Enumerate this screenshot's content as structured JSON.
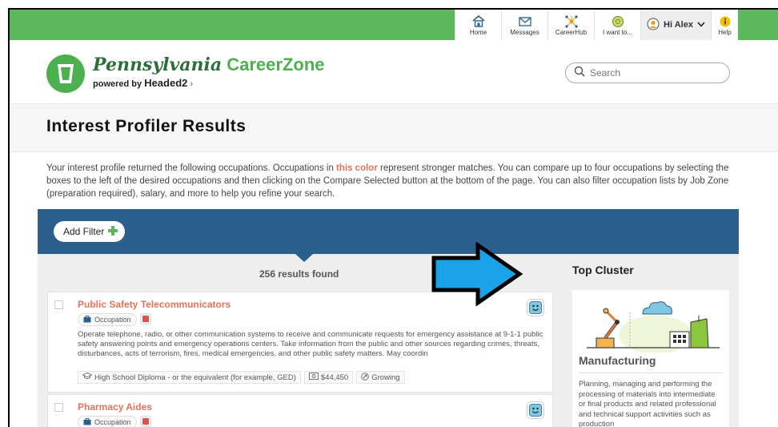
{
  "nav": {
    "items": [
      {
        "label": "Home",
        "icon": "home-icon"
      },
      {
        "label": "Messages",
        "icon": "envelope-icon"
      },
      {
        "label": "CareerHub",
        "icon": "network-icon"
      },
      {
        "label": "I want to...",
        "icon": "compass-icon"
      }
    ],
    "user_greeting": "Hi Alex",
    "help_label": "Help"
  },
  "logo": {
    "title_script": "Pennsylvania",
    "title_brand": "CareerZone",
    "powered_by": "powered by",
    "partner": "Headed2"
  },
  "search": {
    "placeholder": "Search"
  },
  "page_title": "Interest Profiler Results",
  "intro": {
    "part1": "Your interest profile returned the following occupations. Occupations in ",
    "accent": "this color",
    "part2": " represent stronger matches. You can compare up to four occupations by selecting the boxes to the left of the desired occupations and then clicking on the Compare Selected button at the bottom of the page. You can also filter occupation lists by Job Zone (preparation required), salary, and more to help you refine your search."
  },
  "filter": {
    "add_label": "Add Filter"
  },
  "results": {
    "count_text": "256 results found",
    "items": [
      {
        "title": "Public Safety Telecommunicators",
        "badge": "Occupation",
        "description": "Operate telephone, radio, or other communication systems to receive and communicate requests for emergency assistance at 9-1-1 public safety answering points and emergency operations centers. Take information from the public and other sources regarding crimes, threats, disturbances, acts of terrorism, fires, medical emergencies, and other public safety matters. May coordin",
        "education": "High School Diploma - or the equivalent (for example, GED)",
        "salary": "$44,450",
        "outlook": "Growing"
      },
      {
        "title": "Pharmacy Aides",
        "badge": "Occupation"
      }
    ]
  },
  "cluster": {
    "heading": "Top Cluster",
    "name": "Manufacturing",
    "description": "Planning, managing and performing the processing of materials into intermediate or final products and related professional and technical support activities such as production"
  },
  "colors": {
    "top_bar": "#5cb85c",
    "filter_bar": "#2b5f8d",
    "accent": "#e5735a",
    "arrow": "#1aa3e8"
  }
}
